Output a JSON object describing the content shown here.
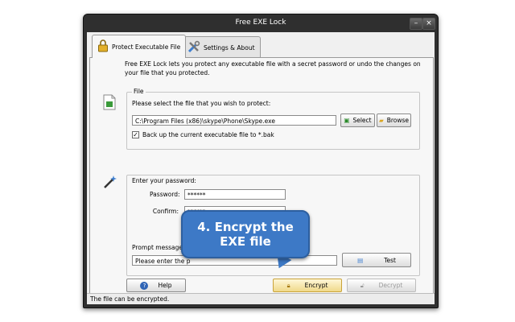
{
  "window": {
    "title": "Free EXE Lock"
  },
  "tabs": [
    {
      "label": "Protect Executable File"
    },
    {
      "label": "Settings & About"
    }
  ],
  "intro": "Free EXE Lock lets you protect any executable file with a secret password or undo the changes on your file that you protected.",
  "file_group": {
    "legend": "File",
    "prompt": "Please select the file that you wish to protect:",
    "path": "C:\\Program Files (x86)\\skype\\Phone\\Skype.exe",
    "select_label": "Select",
    "browse_label": "Browse",
    "backup_label": "Back up the current executable file to *.bak",
    "backup_checked": true
  },
  "password_group": {
    "legend": "Enter your password:",
    "password_label": "Password:",
    "password_value": "******",
    "confirm_label": "Confirm:",
    "confirm_value": "******",
    "prompt_label": "Prompt message o",
    "prompt_value": "Please enter the p",
    "test_label": "Test"
  },
  "actions": {
    "help_label": "Help",
    "encrypt_label": "Encrypt",
    "decrypt_label": "Decrypt"
  },
  "status": "The file can be encrypted.",
  "callout": {
    "line1": "4. Encrypt the",
    "line2": "EXE file"
  },
  "colors": {
    "accent": "#3d79c6",
    "titlebar": "#2f2f2f"
  }
}
